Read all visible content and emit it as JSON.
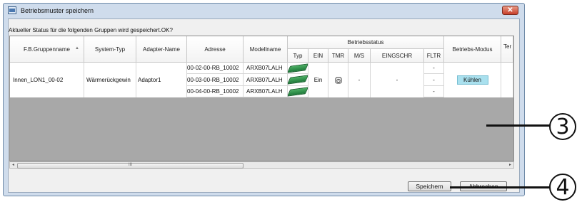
{
  "window": {
    "title": "Betriebsmuster speichern",
    "close_label": "✕"
  },
  "message": "Aktueller Status für die folgenden Gruppen wird gespeichert.OK?",
  "table": {
    "headers": {
      "group_name": "F.B.Gruppenname",
      "system_type": "System-Typ",
      "adapter_name": "Adapter-Name",
      "address": "Adresse",
      "model_name": "Modellname",
      "status_group": "Betriebsstatus",
      "type": "Typ",
      "on": "EIN",
      "tmr": "TMR",
      "ms": "M/S",
      "restrict": "EINGSCHR",
      "fltr": "FLTR",
      "mode": "Betriebs-Modus",
      "temp": "Ter"
    },
    "row": {
      "group_name": "Innen_LON1_00-02",
      "system_type": "Wärmerückgewin",
      "adapter_name": "Adaptor1",
      "on": "Ein",
      "ms": "-",
      "restrict": "-",
      "mode": "Kühlen",
      "units": [
        {
          "address": "00-02-00-RB_10002",
          "model": "ARXB07LALH",
          "fltr": "-"
        },
        {
          "address": "00-03-00-RB_10002",
          "model": "ARXB07LALH",
          "fltr": "-"
        },
        {
          "address": "00-04-00-RB_10002",
          "model": "ARXB07LALH",
          "fltr": "-"
        }
      ]
    }
  },
  "scrollbar": {
    "thumb_grip": "III",
    "left_arrow": "◂",
    "right_arrow": "▸"
  },
  "buttons": {
    "save": "Speichern",
    "cancel": "Abbrechen"
  },
  "callouts": {
    "three": "3",
    "four": "4"
  },
  "icons": {
    "window_icon": "window-icon",
    "timer_icon": "timer-icon",
    "unit_icon": "indoor-unit-icon"
  }
}
